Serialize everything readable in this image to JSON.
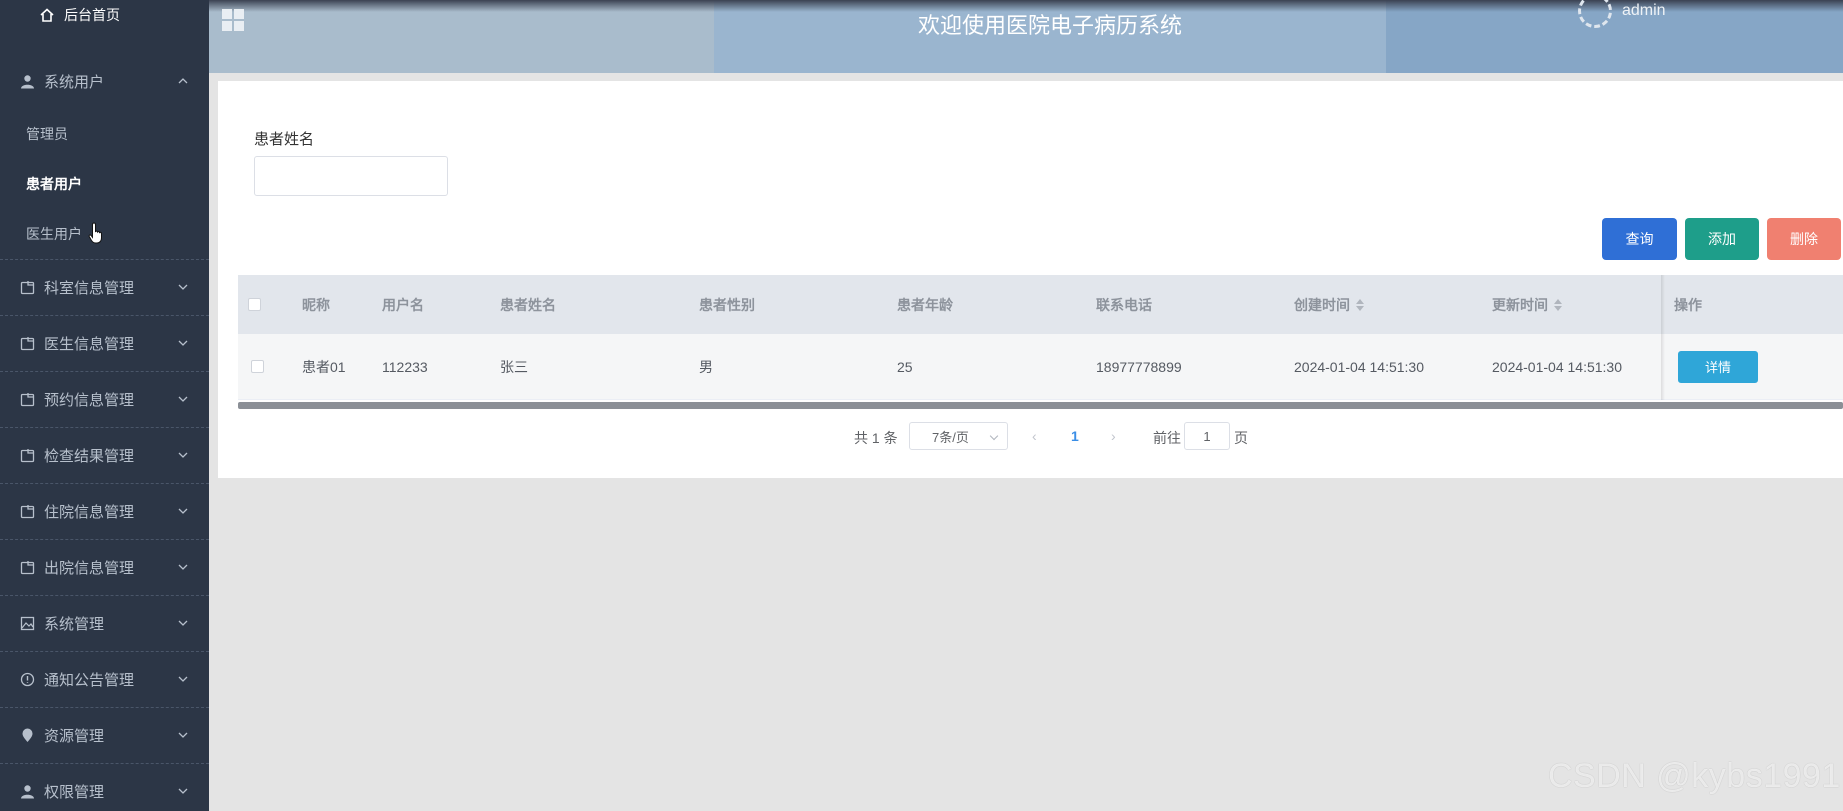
{
  "sidebar": {
    "home_label": "后台首页",
    "groups": [
      {
        "label": "系统用户",
        "icon": "user-icon",
        "expanded": true,
        "items": [
          {
            "label": "管理员",
            "active": false
          },
          {
            "label": "患者用户",
            "active": true
          },
          {
            "label": "医生用户",
            "active": false
          }
        ]
      },
      {
        "label": "科室信息管理",
        "icon": "folder-icon"
      },
      {
        "label": "医生信息管理",
        "icon": "folder-icon"
      },
      {
        "label": "预约信息管理",
        "icon": "folder-icon"
      },
      {
        "label": "检查结果管理",
        "icon": "folder-icon"
      },
      {
        "label": "住院信息管理",
        "icon": "folder-icon"
      },
      {
        "label": "出院信息管理",
        "icon": "folder-icon"
      },
      {
        "label": "系统管理",
        "icon": "picture-icon"
      },
      {
        "label": "通知公告管理",
        "icon": "info-icon"
      },
      {
        "label": "资源管理",
        "icon": "location-icon"
      },
      {
        "label": "权限管理",
        "icon": "user-icon"
      }
    ]
  },
  "header": {
    "title": "欢迎使用医院电子病历系统",
    "username": "admin"
  },
  "filter": {
    "label": "患者姓名",
    "value": ""
  },
  "actions": {
    "query": "查询",
    "add": "添加",
    "delete": "删除"
  },
  "table": {
    "columns": [
      "昵称",
      "用户名",
      "患者姓名",
      "患者性别",
      "患者年龄",
      "联系电话",
      "创建时间",
      "更新时间",
      "操作"
    ],
    "rows": [
      {
        "nickname": "患者01",
        "username": "112233",
        "name": "张三",
        "gender": "男",
        "age": "25",
        "phone": "18977778899",
        "created": "2024-01-04 14:51:30",
        "updated": "2024-01-04 14:51:30",
        "action": "详情"
      }
    ]
  },
  "pagination": {
    "total": "共 1 条",
    "page_size": "7条/页",
    "current": "1",
    "goto_label": "前往",
    "goto_value": "1",
    "page_suffix": "页"
  },
  "watermark": "CSDN @kybs1991",
  "colors": {
    "sidebar_bg": "#2c3646",
    "query": "#2f6fd6",
    "add": "#1e9e8a",
    "delete": "#f08070",
    "detail": "#2fa6d8"
  }
}
